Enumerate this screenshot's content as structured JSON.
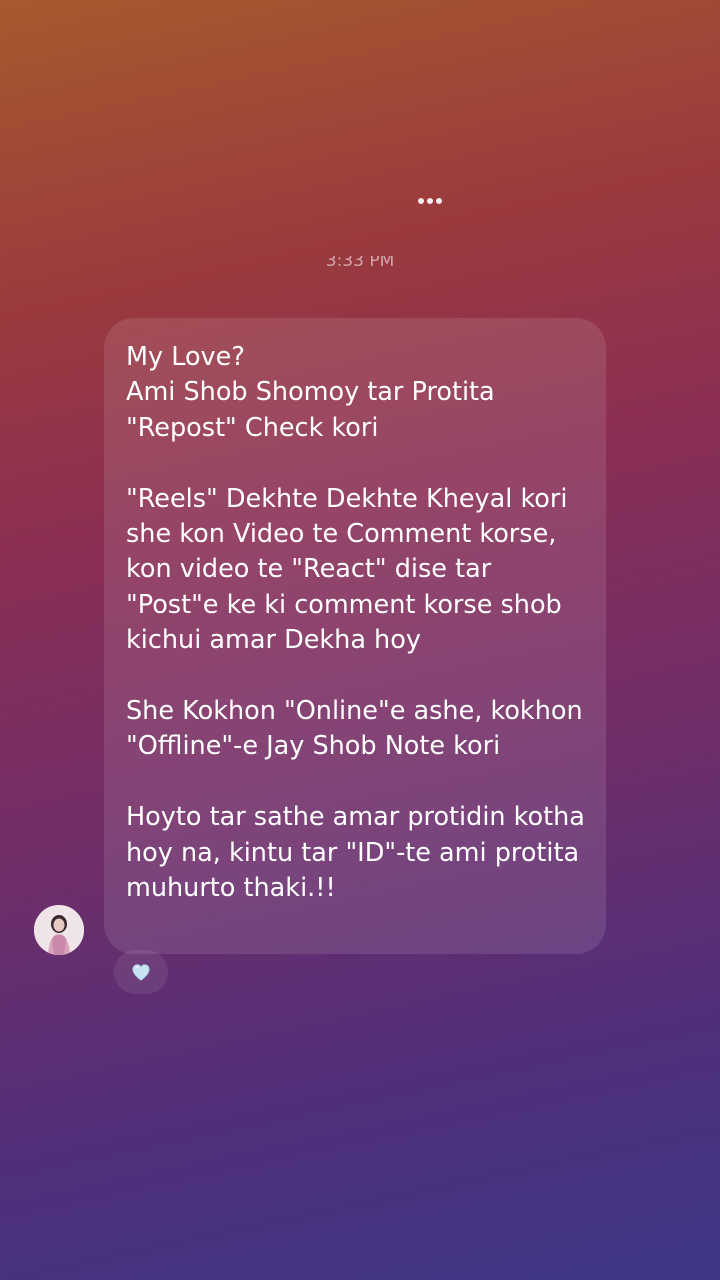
{
  "header": {
    "more_icon": "more-horizontal-icon"
  },
  "thread": {
    "timestamp": "3:33 PM"
  },
  "message": {
    "paragraphs": [
      "My Love?\nAmi Shob Shomoy tar Protita \"Repost\" Check kori",
      "\"Reels\" Dekhte Dekhte Kheyal kori she kon Video te Comment korse, kon video te \"React\" dise tar \"Post\"e ke ki comment korse shob kichui amar Dekha hoy",
      "She Kokhon \"Online\"e ashe, kokhon \"Offline\"-e Jay Shob Note kori",
      "Hoyto tar sathe amar protidin kotha hoy na, kintu tar \"ID\"-te ami protita muhurto thaki.!!"
    ],
    "sender_avatar_icon": "avatar",
    "reaction": {
      "icon": "light-blue-heart-icon",
      "color": "#c8e4f4"
    }
  },
  "colors": {
    "bubble_text": "#ffffff",
    "background_top": "#a65a2e",
    "background_bottom": "#3e3788"
  }
}
